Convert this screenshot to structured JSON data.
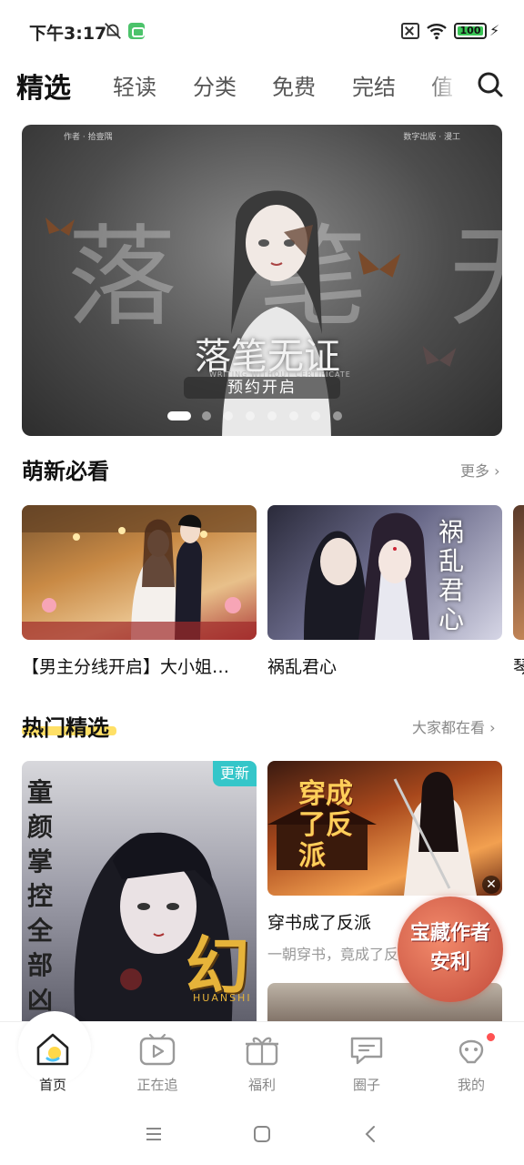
{
  "status": {
    "time": "下午3:17",
    "battery": "100"
  },
  "tabs": [
    {
      "label": "精选",
      "active": true
    },
    {
      "label": "轻读"
    },
    {
      "label": "分类"
    },
    {
      "label": "免费"
    },
    {
      "label": "完结"
    },
    {
      "label": "值"
    }
  ],
  "banner": {
    "credit_left": "作者 · 拾壹隅",
    "credit_right": "数字出版 · 漫工",
    "big_text": "落笔无证",
    "title": "落笔无证",
    "subtitle": "WRITING WITHOUT CERTIFICATE",
    "button": "预约开启",
    "dot_count": 8
  },
  "section_new": {
    "title": "萌新必看",
    "more": "更多 ›",
    "cards": [
      {
        "title": "【男主分线开启】大小姐…"
      },
      {
        "title": "祸乱君心",
        "cover_text": "祸乱君心"
      },
      {
        "title": "琴"
      }
    ]
  },
  "section_hot": {
    "title": "热门精选",
    "more": "大家都在看 ›",
    "card_left": {
      "badge": "更新",
      "vertical_text": "童颜掌控全部凶兽",
      "big_text": "幻",
      "pinyin": "HUANSHI"
    },
    "card_right": {
      "title": "穿书成了反派",
      "subtitle": "一朝穿书，竟成了反派",
      "cover_text": "穿成了反派"
    }
  },
  "ad": {
    "text": "宝藏作者安利",
    "close": "✕"
  },
  "bottom_nav": [
    {
      "label": "首页",
      "icon": "home-icon",
      "active": true
    },
    {
      "label": "正在追",
      "icon": "video-icon"
    },
    {
      "label": "福利",
      "icon": "gift-icon"
    },
    {
      "label": "圈子",
      "icon": "chat-icon"
    },
    {
      "label": "我的",
      "icon": "profile-icon",
      "dot": true
    }
  ]
}
